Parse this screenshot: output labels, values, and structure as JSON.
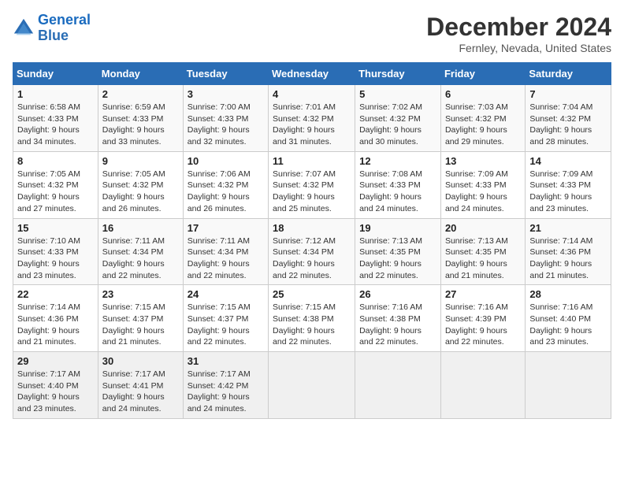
{
  "header": {
    "logo_line1": "General",
    "logo_line2": "Blue",
    "title": "December 2024",
    "location": "Fernley, Nevada, United States"
  },
  "days_of_week": [
    "Sunday",
    "Monday",
    "Tuesday",
    "Wednesday",
    "Thursday",
    "Friday",
    "Saturday"
  ],
  "weeks": [
    [
      {
        "day": "1",
        "info": "Sunrise: 6:58 AM\nSunset: 4:33 PM\nDaylight: 9 hours\nand 34 minutes."
      },
      {
        "day": "2",
        "info": "Sunrise: 6:59 AM\nSunset: 4:33 PM\nDaylight: 9 hours\nand 33 minutes."
      },
      {
        "day": "3",
        "info": "Sunrise: 7:00 AM\nSunset: 4:33 PM\nDaylight: 9 hours\nand 32 minutes."
      },
      {
        "day": "4",
        "info": "Sunrise: 7:01 AM\nSunset: 4:32 PM\nDaylight: 9 hours\nand 31 minutes."
      },
      {
        "day": "5",
        "info": "Sunrise: 7:02 AM\nSunset: 4:32 PM\nDaylight: 9 hours\nand 30 minutes."
      },
      {
        "day": "6",
        "info": "Sunrise: 7:03 AM\nSunset: 4:32 PM\nDaylight: 9 hours\nand 29 minutes."
      },
      {
        "day": "7",
        "info": "Sunrise: 7:04 AM\nSunset: 4:32 PM\nDaylight: 9 hours\nand 28 minutes."
      }
    ],
    [
      {
        "day": "8",
        "info": "Sunrise: 7:05 AM\nSunset: 4:32 PM\nDaylight: 9 hours\nand 27 minutes."
      },
      {
        "day": "9",
        "info": "Sunrise: 7:05 AM\nSunset: 4:32 PM\nDaylight: 9 hours\nand 26 minutes."
      },
      {
        "day": "10",
        "info": "Sunrise: 7:06 AM\nSunset: 4:32 PM\nDaylight: 9 hours\nand 26 minutes."
      },
      {
        "day": "11",
        "info": "Sunrise: 7:07 AM\nSunset: 4:32 PM\nDaylight: 9 hours\nand 25 minutes."
      },
      {
        "day": "12",
        "info": "Sunrise: 7:08 AM\nSunset: 4:33 PM\nDaylight: 9 hours\nand 24 minutes."
      },
      {
        "day": "13",
        "info": "Sunrise: 7:09 AM\nSunset: 4:33 PM\nDaylight: 9 hours\nand 24 minutes."
      },
      {
        "day": "14",
        "info": "Sunrise: 7:09 AM\nSunset: 4:33 PM\nDaylight: 9 hours\nand 23 minutes."
      }
    ],
    [
      {
        "day": "15",
        "info": "Sunrise: 7:10 AM\nSunset: 4:33 PM\nDaylight: 9 hours\nand 23 minutes."
      },
      {
        "day": "16",
        "info": "Sunrise: 7:11 AM\nSunset: 4:34 PM\nDaylight: 9 hours\nand 22 minutes."
      },
      {
        "day": "17",
        "info": "Sunrise: 7:11 AM\nSunset: 4:34 PM\nDaylight: 9 hours\nand 22 minutes."
      },
      {
        "day": "18",
        "info": "Sunrise: 7:12 AM\nSunset: 4:34 PM\nDaylight: 9 hours\nand 22 minutes."
      },
      {
        "day": "19",
        "info": "Sunrise: 7:13 AM\nSunset: 4:35 PM\nDaylight: 9 hours\nand 22 minutes."
      },
      {
        "day": "20",
        "info": "Sunrise: 7:13 AM\nSunset: 4:35 PM\nDaylight: 9 hours\nand 21 minutes."
      },
      {
        "day": "21",
        "info": "Sunrise: 7:14 AM\nSunset: 4:36 PM\nDaylight: 9 hours\nand 21 minutes."
      }
    ],
    [
      {
        "day": "22",
        "info": "Sunrise: 7:14 AM\nSunset: 4:36 PM\nDaylight: 9 hours\nand 21 minutes."
      },
      {
        "day": "23",
        "info": "Sunrise: 7:15 AM\nSunset: 4:37 PM\nDaylight: 9 hours\nand 21 minutes."
      },
      {
        "day": "24",
        "info": "Sunrise: 7:15 AM\nSunset: 4:37 PM\nDaylight: 9 hours\nand 22 minutes."
      },
      {
        "day": "25",
        "info": "Sunrise: 7:15 AM\nSunset: 4:38 PM\nDaylight: 9 hours\nand 22 minutes."
      },
      {
        "day": "26",
        "info": "Sunrise: 7:16 AM\nSunset: 4:38 PM\nDaylight: 9 hours\nand 22 minutes."
      },
      {
        "day": "27",
        "info": "Sunrise: 7:16 AM\nSunset: 4:39 PM\nDaylight: 9 hours\nand 22 minutes."
      },
      {
        "day": "28",
        "info": "Sunrise: 7:16 AM\nSunset: 4:40 PM\nDaylight: 9 hours\nand 23 minutes."
      }
    ],
    [
      {
        "day": "29",
        "info": "Sunrise: 7:17 AM\nSunset: 4:40 PM\nDaylight: 9 hours\nand 23 minutes."
      },
      {
        "day": "30",
        "info": "Sunrise: 7:17 AM\nSunset: 4:41 PM\nDaylight: 9 hours\nand 24 minutes."
      },
      {
        "day": "31",
        "info": "Sunrise: 7:17 AM\nSunset: 4:42 PM\nDaylight: 9 hours\nand 24 minutes."
      },
      {
        "day": "",
        "info": ""
      },
      {
        "day": "",
        "info": ""
      },
      {
        "day": "",
        "info": ""
      },
      {
        "day": "",
        "info": ""
      }
    ]
  ]
}
